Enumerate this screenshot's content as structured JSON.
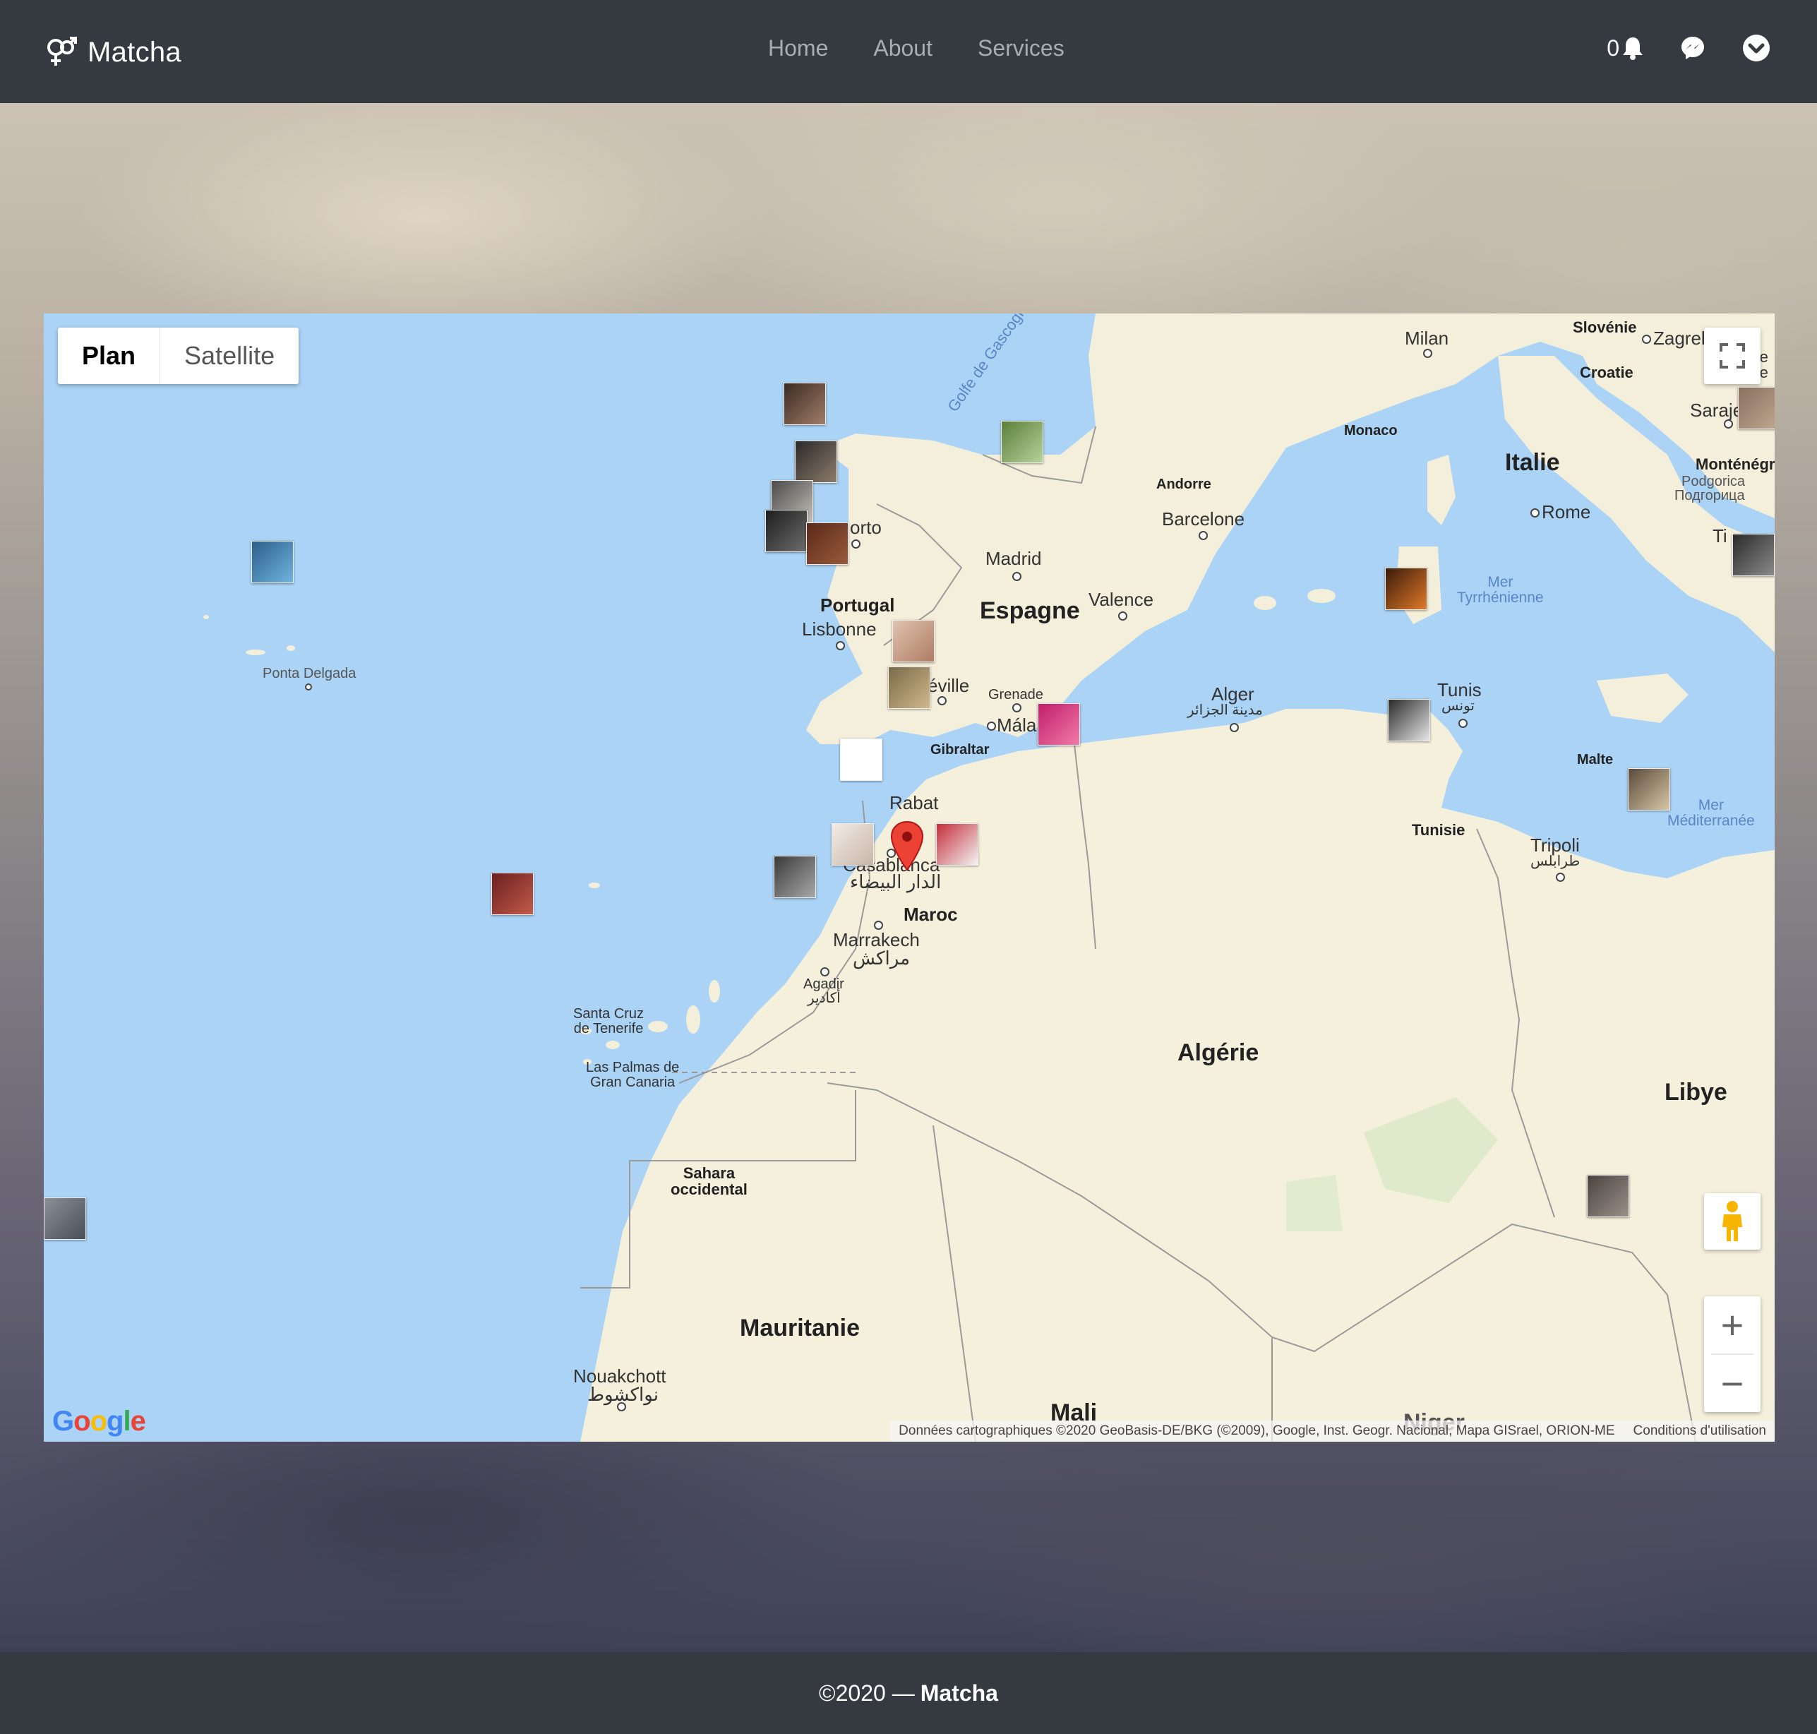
{
  "navbar": {
    "brand": "Matcha",
    "links": [
      "Home",
      "About",
      "Services"
    ],
    "notification_count": "0"
  },
  "map": {
    "type_buttons": {
      "plan": "Plan",
      "satellite": "Satellite"
    },
    "zoom_in": "+",
    "zoom_out": "−",
    "google_logo": "Google",
    "attribution": "Données cartographiques ©2020 GeoBasis-DE/BKG (©2009), Google, Inst. Geogr. Nacional, Mapa GISrael, ORION-ME",
    "terms": "Conditions d'utilisation",
    "countries": {
      "espagne": "Espagne",
      "portugal": "Portugal",
      "italie": "Italie",
      "maroc": "Maroc",
      "algerie": "Algérie",
      "libye": "Libye",
      "mauritanie": "Mauritanie",
      "mali": "Mali",
      "tunisie": "Tunisie",
      "croatie": "Croatie",
      "slovenie": "Slovénie",
      "montenegro": "Monténégro",
      "sahara1": "Sahara",
      "sahara2": "occidental",
      "niger": "Niger",
      "andorre": "Andorre",
      "monaco": "Monaco",
      "malte": "Malte",
      "gibraltar": "Gibraltar"
    },
    "cities": {
      "madrid": "Madrid",
      "barcelone": "Barcelone",
      "valence": "Valence",
      "lisbonne": "Lisbonne",
      "porto": "orto",
      "seville": "éville",
      "grenade": "Grenade",
      "malaga": "Mála",
      "rabat": "Rabat",
      "casablanca": "Casablanca",
      "casablanca_ar": "الدار البيضاء",
      "marrakech": "Marrakech",
      "marrakech_ar": "مراكش",
      "agadir": "Agadir",
      "agadir_ar": "أكادير",
      "alger": "Alger",
      "alger_ar": "مدينة الجزائر",
      "tunis": "Tunis",
      "tunis_ar": "تونس",
      "tripoli": "Tripoli",
      "tripoli_ar": "طرابلس",
      "rome": "Rome",
      "milan": "Milan",
      "zagreb": "Zagrel",
      "sarajevo": "Saraje",
      "tirana": "Ti",
      "podgorica1": "Podgorica",
      "podgorica2": "Подгорица",
      "ponta_delgada": "Ponta Delgada",
      "tenerife1": "Santa Cruz",
      "tenerife2": "de Tenerife",
      "las_palmas1": "Las Palmas de",
      "las_palmas2": "Gran Canaria",
      "nouakchott": "Nouakchott",
      "nouakchott_ar": "نواكشوط",
      "be1": "Be",
      "be2": "Be"
    },
    "seas": {
      "tyrrhenian1": "Mer",
      "tyrrhenian2": "Tyrrhénienne",
      "mediterranean1": "Mer",
      "mediterranean2": "Méditerranée",
      "gulf": "Golfe de Gascogn"
    }
  },
  "footer": {
    "copyright": "©2020 —",
    "brand": "Matcha"
  },
  "colors": {
    "navbar": "#343a40",
    "water": "#aad3f5",
    "land": "#f5f0dc",
    "marker": "#ea4335"
  }
}
